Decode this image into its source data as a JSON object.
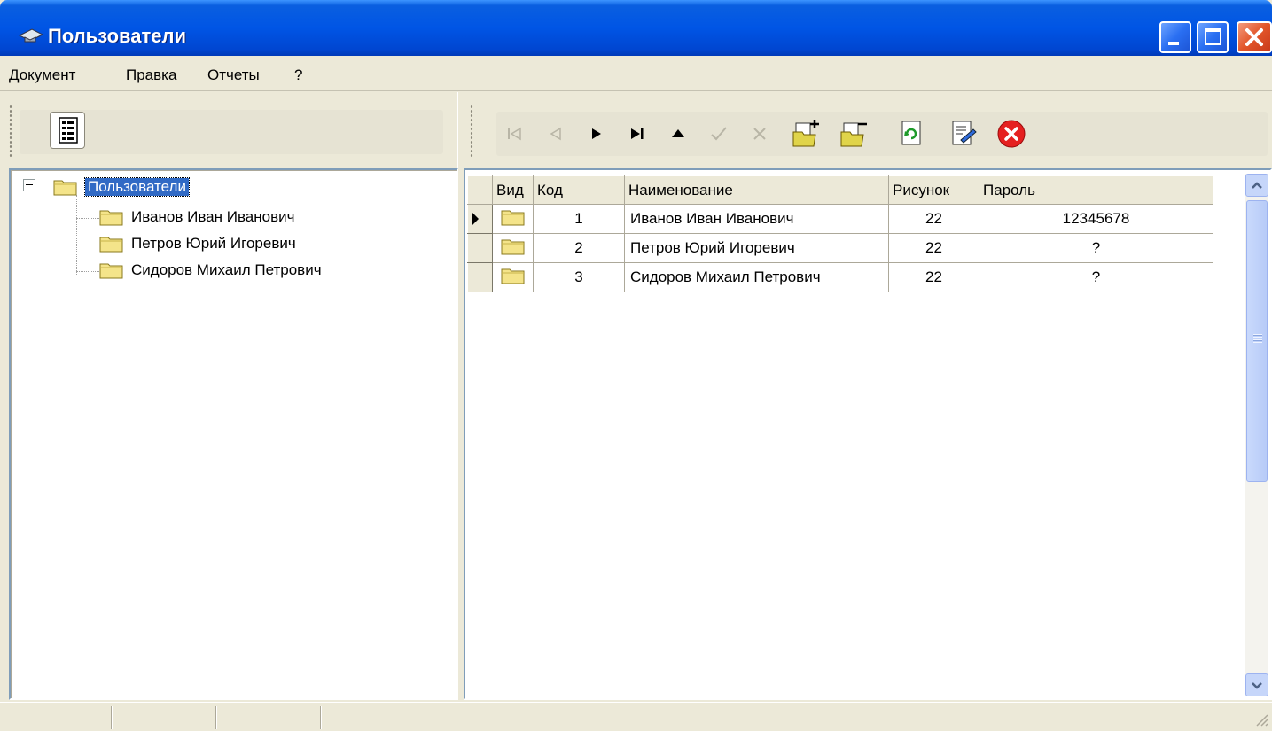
{
  "window": {
    "title": "Пользователи"
  },
  "menu": {
    "items": [
      "Документ",
      "Правка",
      "Отчеты",
      "?"
    ]
  },
  "tree": {
    "root": "Пользователи",
    "children": [
      "Иванов Иван Иванович",
      "Петров Юрий Игоревич",
      "Сидоров Михаил Петрович"
    ]
  },
  "grid": {
    "columns": [
      "Вид",
      "Код",
      "Наименование",
      "Рисунок",
      "Пароль"
    ],
    "rows": [
      {
        "code": "1",
        "name": "Иванов Иван Иванович",
        "picture": "22",
        "password": "12345678"
      },
      {
        "code": "2",
        "name": "Петров Юрий Игоревич",
        "picture": "22",
        "password": "?"
      },
      {
        "code": "3",
        "name": "Сидоров Михаил Петрович",
        "picture": "22",
        "password": "?"
      }
    ],
    "current_row": 1
  },
  "toolbar": {
    "navigator": [
      "first-record-icon",
      "prior-record-icon",
      "next-record-icon",
      "last-record-icon",
      "insert-record-icon",
      "post-record-icon",
      "cancel-record-icon"
    ],
    "actions": [
      "add-document-icon",
      "remove-document-icon",
      "refresh-icon",
      "edit-document-icon",
      "close-red-icon"
    ]
  },
  "colors": {
    "title_bar": "#0055e5",
    "selection": "#316ac5",
    "close_button": "#e2562a",
    "window_face": "#ece9d8"
  }
}
